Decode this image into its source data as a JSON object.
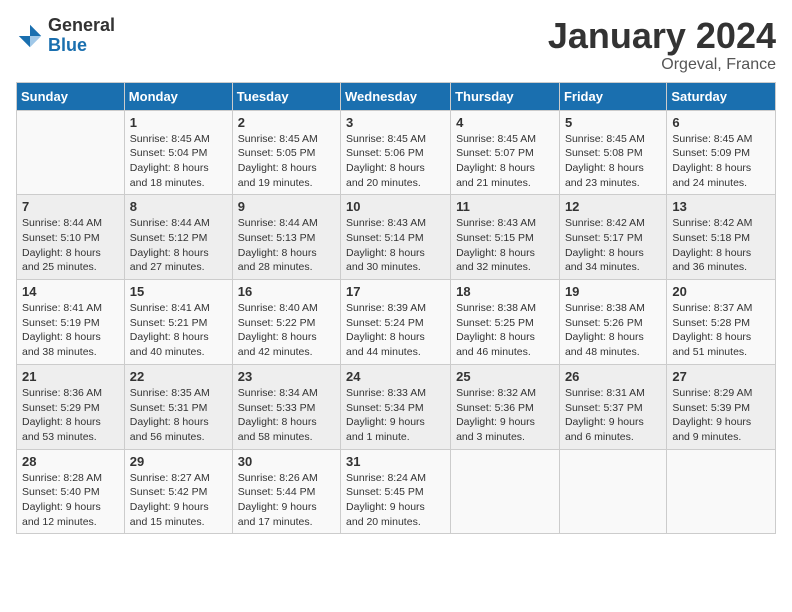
{
  "logo": {
    "general": "General",
    "blue": "Blue"
  },
  "title": "January 2024",
  "location": "Orgeval, France",
  "days_of_week": [
    "Sunday",
    "Monday",
    "Tuesday",
    "Wednesday",
    "Thursday",
    "Friday",
    "Saturday"
  ],
  "weeks": [
    [
      {
        "day": "",
        "sunrise": "",
        "sunset": "",
        "daylight": ""
      },
      {
        "day": "1",
        "sunrise": "Sunrise: 8:45 AM",
        "sunset": "Sunset: 5:04 PM",
        "daylight": "Daylight: 8 hours and 18 minutes."
      },
      {
        "day": "2",
        "sunrise": "Sunrise: 8:45 AM",
        "sunset": "Sunset: 5:05 PM",
        "daylight": "Daylight: 8 hours and 19 minutes."
      },
      {
        "day": "3",
        "sunrise": "Sunrise: 8:45 AM",
        "sunset": "Sunset: 5:06 PM",
        "daylight": "Daylight: 8 hours and 20 minutes."
      },
      {
        "day": "4",
        "sunrise": "Sunrise: 8:45 AM",
        "sunset": "Sunset: 5:07 PM",
        "daylight": "Daylight: 8 hours and 21 minutes."
      },
      {
        "day": "5",
        "sunrise": "Sunrise: 8:45 AM",
        "sunset": "Sunset: 5:08 PM",
        "daylight": "Daylight: 8 hours and 23 minutes."
      },
      {
        "day": "6",
        "sunrise": "Sunrise: 8:45 AM",
        "sunset": "Sunset: 5:09 PM",
        "daylight": "Daylight: 8 hours and 24 minutes."
      }
    ],
    [
      {
        "day": "7",
        "sunrise": "Sunrise: 8:44 AM",
        "sunset": "Sunset: 5:10 PM",
        "daylight": "Daylight: 8 hours and 25 minutes."
      },
      {
        "day": "8",
        "sunrise": "Sunrise: 8:44 AM",
        "sunset": "Sunset: 5:12 PM",
        "daylight": "Daylight: 8 hours and 27 minutes."
      },
      {
        "day": "9",
        "sunrise": "Sunrise: 8:44 AM",
        "sunset": "Sunset: 5:13 PM",
        "daylight": "Daylight: 8 hours and 28 minutes."
      },
      {
        "day": "10",
        "sunrise": "Sunrise: 8:43 AM",
        "sunset": "Sunset: 5:14 PM",
        "daylight": "Daylight: 8 hours and 30 minutes."
      },
      {
        "day": "11",
        "sunrise": "Sunrise: 8:43 AM",
        "sunset": "Sunset: 5:15 PM",
        "daylight": "Daylight: 8 hours and 32 minutes."
      },
      {
        "day": "12",
        "sunrise": "Sunrise: 8:42 AM",
        "sunset": "Sunset: 5:17 PM",
        "daylight": "Daylight: 8 hours and 34 minutes."
      },
      {
        "day": "13",
        "sunrise": "Sunrise: 8:42 AM",
        "sunset": "Sunset: 5:18 PM",
        "daylight": "Daylight: 8 hours and 36 minutes."
      }
    ],
    [
      {
        "day": "14",
        "sunrise": "Sunrise: 8:41 AM",
        "sunset": "Sunset: 5:19 PM",
        "daylight": "Daylight: 8 hours and 38 minutes."
      },
      {
        "day": "15",
        "sunrise": "Sunrise: 8:41 AM",
        "sunset": "Sunset: 5:21 PM",
        "daylight": "Daylight: 8 hours and 40 minutes."
      },
      {
        "day": "16",
        "sunrise": "Sunrise: 8:40 AM",
        "sunset": "Sunset: 5:22 PM",
        "daylight": "Daylight: 8 hours and 42 minutes."
      },
      {
        "day": "17",
        "sunrise": "Sunrise: 8:39 AM",
        "sunset": "Sunset: 5:24 PM",
        "daylight": "Daylight: 8 hours and 44 minutes."
      },
      {
        "day": "18",
        "sunrise": "Sunrise: 8:38 AM",
        "sunset": "Sunset: 5:25 PM",
        "daylight": "Daylight: 8 hours and 46 minutes."
      },
      {
        "day": "19",
        "sunrise": "Sunrise: 8:38 AM",
        "sunset": "Sunset: 5:26 PM",
        "daylight": "Daylight: 8 hours and 48 minutes."
      },
      {
        "day": "20",
        "sunrise": "Sunrise: 8:37 AM",
        "sunset": "Sunset: 5:28 PM",
        "daylight": "Daylight: 8 hours and 51 minutes."
      }
    ],
    [
      {
        "day": "21",
        "sunrise": "Sunrise: 8:36 AM",
        "sunset": "Sunset: 5:29 PM",
        "daylight": "Daylight: 8 hours and 53 minutes."
      },
      {
        "day": "22",
        "sunrise": "Sunrise: 8:35 AM",
        "sunset": "Sunset: 5:31 PM",
        "daylight": "Daylight: 8 hours and 56 minutes."
      },
      {
        "day": "23",
        "sunrise": "Sunrise: 8:34 AM",
        "sunset": "Sunset: 5:33 PM",
        "daylight": "Daylight: 8 hours and 58 minutes."
      },
      {
        "day": "24",
        "sunrise": "Sunrise: 8:33 AM",
        "sunset": "Sunset: 5:34 PM",
        "daylight": "Daylight: 9 hours and 1 minute."
      },
      {
        "day": "25",
        "sunrise": "Sunrise: 8:32 AM",
        "sunset": "Sunset: 5:36 PM",
        "daylight": "Daylight: 9 hours and 3 minutes."
      },
      {
        "day": "26",
        "sunrise": "Sunrise: 8:31 AM",
        "sunset": "Sunset: 5:37 PM",
        "daylight": "Daylight: 9 hours and 6 minutes."
      },
      {
        "day": "27",
        "sunrise": "Sunrise: 8:29 AM",
        "sunset": "Sunset: 5:39 PM",
        "daylight": "Daylight: 9 hours and 9 minutes."
      }
    ],
    [
      {
        "day": "28",
        "sunrise": "Sunrise: 8:28 AM",
        "sunset": "Sunset: 5:40 PM",
        "daylight": "Daylight: 9 hours and 12 minutes."
      },
      {
        "day": "29",
        "sunrise": "Sunrise: 8:27 AM",
        "sunset": "Sunset: 5:42 PM",
        "daylight": "Daylight: 9 hours and 15 minutes."
      },
      {
        "day": "30",
        "sunrise": "Sunrise: 8:26 AM",
        "sunset": "Sunset: 5:44 PM",
        "daylight": "Daylight: 9 hours and 17 minutes."
      },
      {
        "day": "31",
        "sunrise": "Sunrise: 8:24 AM",
        "sunset": "Sunset: 5:45 PM",
        "daylight": "Daylight: 9 hours and 20 minutes."
      },
      {
        "day": "",
        "sunrise": "",
        "sunset": "",
        "daylight": ""
      },
      {
        "day": "",
        "sunrise": "",
        "sunset": "",
        "daylight": ""
      },
      {
        "day": "",
        "sunrise": "",
        "sunset": "",
        "daylight": ""
      }
    ]
  ]
}
